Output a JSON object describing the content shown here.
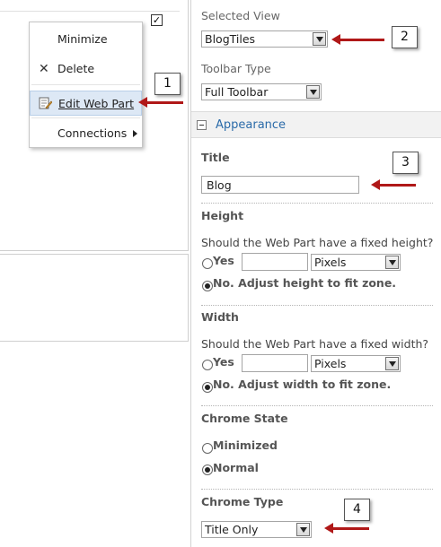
{
  "context_menu": {
    "items": [
      {
        "label": "Minimize",
        "icon": ""
      },
      {
        "label": "Delete",
        "icon": "delete-x-icon"
      },
      {
        "label": "Edit Web Part",
        "icon": "edit-web-part-icon"
      },
      {
        "label": "Connections",
        "icon": "submenu-arrow-icon"
      }
    ],
    "checkbox_checked": true
  },
  "panel": {
    "selected_view_label": "Selected View",
    "selected_view_value": "BlogTiles",
    "toolbar_type_label": "Toolbar Type",
    "toolbar_type_value": "Full Toolbar",
    "appearance_section": "Appearance",
    "title_label": "Title",
    "title_value": "Blog",
    "height_label": "Height",
    "height_question": "Should the Web Part have a fixed height?",
    "height_yes_label": "Yes",
    "height_unit": "Pixels",
    "height_no_label": "No. Adjust height to fit zone.",
    "width_label": "Width",
    "width_question": "Should the Web Part have a fixed width?",
    "width_yes_label": "Yes",
    "width_unit": "Pixels",
    "width_no_label": "No. Adjust width to fit zone.",
    "chrome_state_label": "Chrome State",
    "chrome_state_minimized": "Minimized",
    "chrome_state_normal": "Normal",
    "chrome_type_label": "Chrome Type",
    "chrome_type_value": "Title Only"
  },
  "callouts": [
    "1",
    "2",
    "3",
    "4"
  ],
  "colors": {
    "arrow": "#b01818",
    "section_link": "#2b6ba9",
    "menu_highlight": "#dde8f5"
  }
}
